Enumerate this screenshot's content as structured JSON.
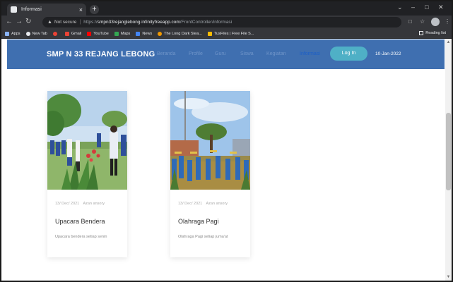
{
  "browser": {
    "tab_title": "Informasi",
    "tab_close": "×",
    "new_tab": "+",
    "window_controls": {
      "chevron": "⌄",
      "minimize": "–",
      "maximize": "□",
      "close": "✕"
    },
    "address": {
      "not_secure": "Not secure",
      "separator": "|",
      "scheme": "https://",
      "host": "smpn33rejanglebong.infinityfreeapp.com",
      "path": "/FrontController/informasi"
    },
    "bookmarks": [
      {
        "label": "Apps",
        "color": "#8ab4f8"
      },
      {
        "label": "New Tab",
        "color": "#e8eaed"
      },
      {
        "label": "",
        "color": "#ea4335"
      },
      {
        "label": "Gmail",
        "color": "#ea4335"
      },
      {
        "label": "YouTube",
        "color": "#ff0000"
      },
      {
        "label": "Maps",
        "color": "#34a853"
      },
      {
        "label": "News",
        "color": "#4285f4"
      },
      {
        "label": "The Long Dark Stea...",
        "color": "#f29900"
      },
      {
        "label": "TusFiles | Free File S...",
        "color": "#fbbc04"
      }
    ],
    "reading_list": "Reading list"
  },
  "site": {
    "brand": "SMP N 33 REJANG LEBONG",
    "nav": [
      {
        "label": "Beranda",
        "active": false
      },
      {
        "label": "Profile",
        "active": false
      },
      {
        "label": "Guru",
        "active": false
      },
      {
        "label": "Siswa",
        "active": false
      },
      {
        "label": "Kegiatan",
        "active": false
      },
      {
        "label": "Informasi",
        "active": true
      }
    ],
    "login_label": "Log In",
    "date": "10-Jan-2022"
  },
  "cards": [
    {
      "date": "13/ Dec/ 2021",
      "author": "Azan ansory",
      "title": "Upacara Bendera",
      "description": "Upacara bendera setiap senin"
    },
    {
      "date": "13/ Dec/ 2021",
      "author": "Azan ansory",
      "title": "Olahraga Pagi",
      "description": "Olahraga Pagi setiap juma'at"
    }
  ],
  "colors": {
    "navbar": "#3f6fb0",
    "login_button": "#4fb0c6",
    "nav_active": "#1c5fc7"
  }
}
